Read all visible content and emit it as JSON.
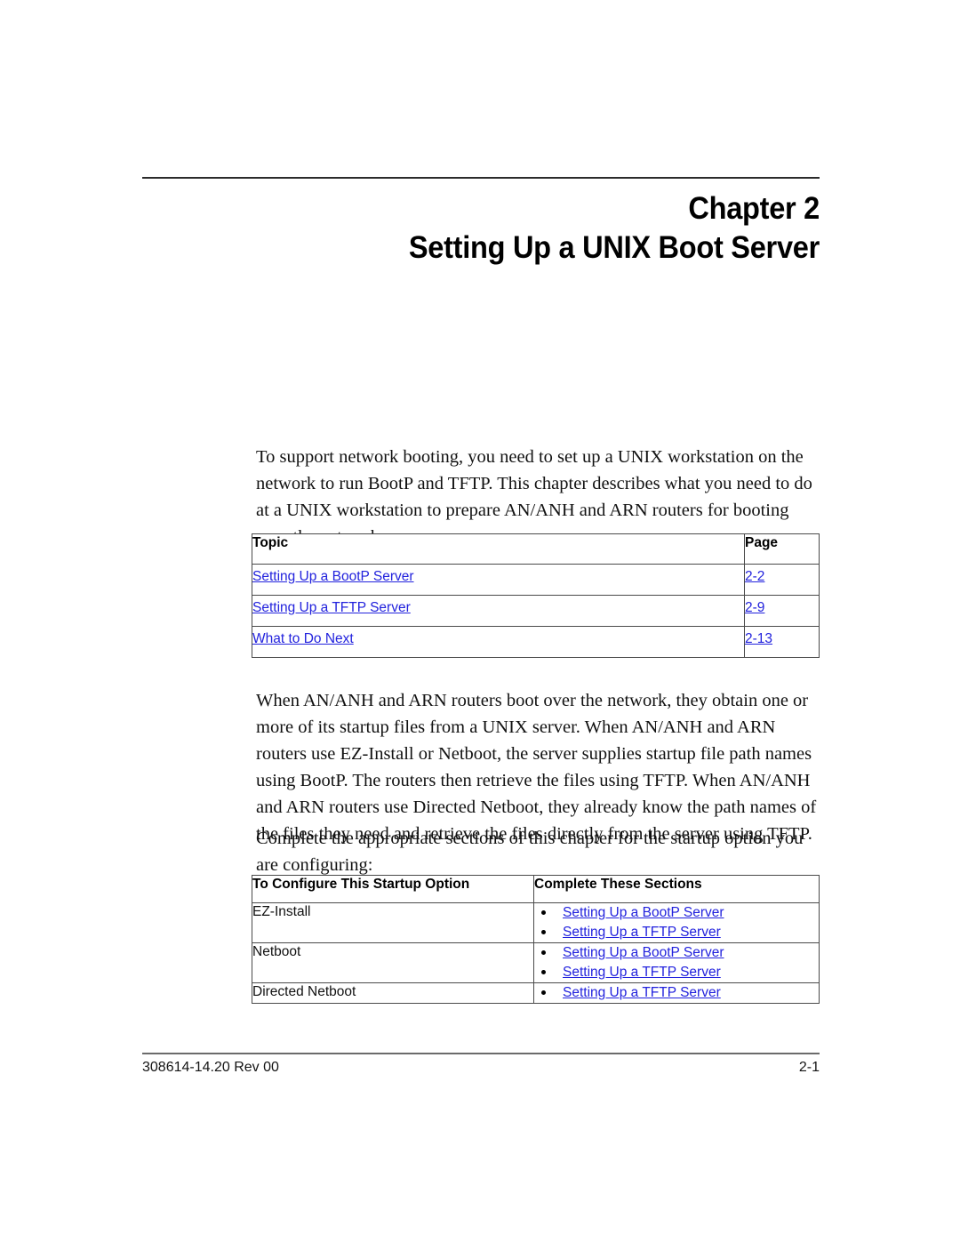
{
  "document": {
    "chapter_label": "Chapter 2",
    "chapter_title": "Setting Up a UNIX Boot Server"
  },
  "paragraphs": {
    "intro": "To support network booting, you need to set up a UNIX workstation on the network to run BootP and TFTP. This chapter describes what you need to do at a UNIX workstation to prepare AN/ANH and ARN routers for booting over the network.",
    "boot_process": "When AN/ANH and ARN routers boot over the network, they obtain one or more of its startup files from a UNIX server. When AN/ANH and ARN routers use EZ-Install or Netboot, the server supplies startup file path names using BootP. The routers then retrieve the files using TFTP. When AN/ANH and ARN routers use Directed Netboot, they already know the path names of the files they need and retrieve the files directly from the server using TFTP.",
    "complete_sections": "Complete the appropriate sections of this chapter for the startup option you are configuring:"
  },
  "topic_table": {
    "headers": {
      "topic": "Topic",
      "page": "Page"
    },
    "rows": [
      {
        "topic": "Setting Up a BootP Server",
        "page": "2-2"
      },
      {
        "topic": "Setting Up a TFTP Server",
        "page": "2-9"
      },
      {
        "topic": "What to Do Next",
        "page": "2-13"
      }
    ]
  },
  "startup_table": {
    "headers": {
      "option": "To Configure This Startup Option",
      "sections": "Complete These Sections"
    },
    "rows": [
      {
        "option": "EZ-Install",
        "sections": [
          "Setting Up a BootP Server",
          "Setting Up a TFTP Server"
        ]
      },
      {
        "option": "Netboot",
        "sections": [
          "Setting Up a BootP Server",
          "Setting Up a TFTP Server"
        ]
      },
      {
        "option": "Directed Netboot",
        "sections": [
          "Setting Up a TFTP Server"
        ]
      }
    ]
  },
  "footer": {
    "doc_number": "308614-14.20 Rev 00",
    "page_number": "2-1"
  },
  "colors": {
    "link": "#2222DD",
    "text": "#000000",
    "rule": "#2b2b2b",
    "table_border": "#4a4a4a"
  }
}
